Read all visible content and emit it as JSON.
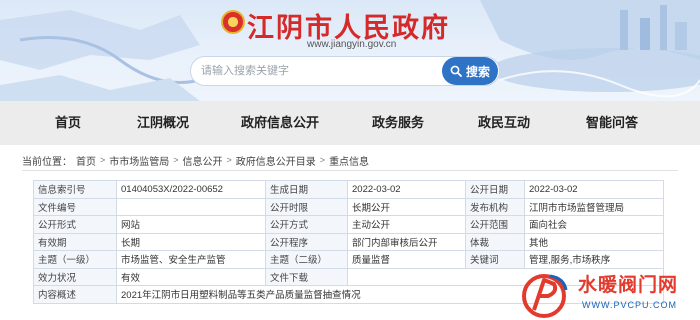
{
  "header": {
    "site_title": "江阴市人民政府",
    "site_url": "www.jiangyin.gov.cn",
    "search_placeholder": "请输入搜索关键字",
    "search_button": "搜索"
  },
  "nav": [
    "首页",
    "江阴概况",
    "政府信息公开",
    "政务服务",
    "政民互动",
    "智能问答"
  ],
  "breadcrumb": {
    "prefix": "当前位置：",
    "items": [
      "首页",
      "市市场监管局",
      "信息公开",
      "政府信息公开目录",
      "重点信息"
    ]
  },
  "info_table": {
    "rows": [
      [
        "信息索引号",
        "01404053X/2022-00652",
        "生成日期",
        "2022-03-02",
        "公开日期",
        "2022-03-02"
      ],
      [
        "文件编号",
        "",
        "公开时限",
        "长期公开",
        "发布机构",
        "江阴市市场监督管理局"
      ],
      [
        "公开形式",
        "网站",
        "公开方式",
        "主动公开",
        "公开范围",
        "面向社会"
      ],
      [
        "有效期",
        "长期",
        "公开程序",
        "部门内部审核后公开",
        "体裁",
        "其他"
      ],
      [
        "主题（一级）",
        "市场监管、安全生产监管",
        "主题（二级）",
        "质量监督",
        "关键词",
        "管理,服务,市场秩序"
      ],
      [
        "效力状况",
        "有效",
        "文件下载",
        ""
      ],
      [
        "内容概述",
        "2021年江阴市日用塑料制品等五类产品质量监督抽查情况"
      ]
    ]
  },
  "watermark": {
    "text": "水暖阀门网",
    "url": "WWW.PVCPU.COM"
  },
  "colors": {
    "title_red": "#d42a2a",
    "search_blue": "#2f73c7",
    "nav_bg": "#ececec",
    "table_key_bg": "#f3f7fc"
  }
}
